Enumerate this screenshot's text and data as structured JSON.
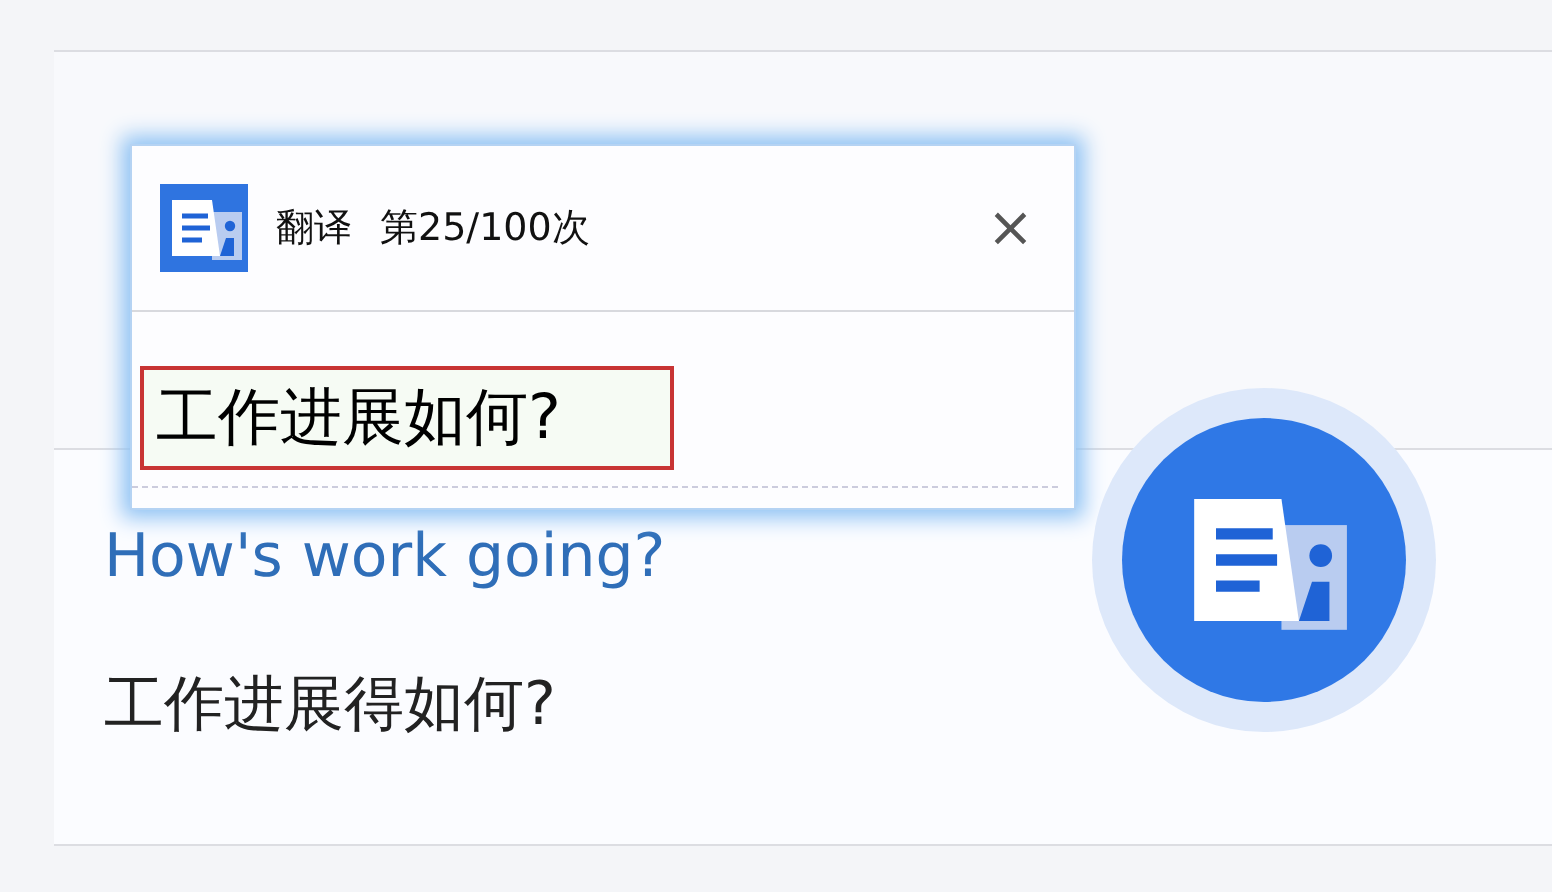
{
  "cards": [
    {
      "english": "How's work going?",
      "chinese": "工作进展得如何?"
    }
  ],
  "popup": {
    "title": "翻译",
    "count": "第25/100次",
    "close": "×",
    "result": "工作进展如何?"
  }
}
